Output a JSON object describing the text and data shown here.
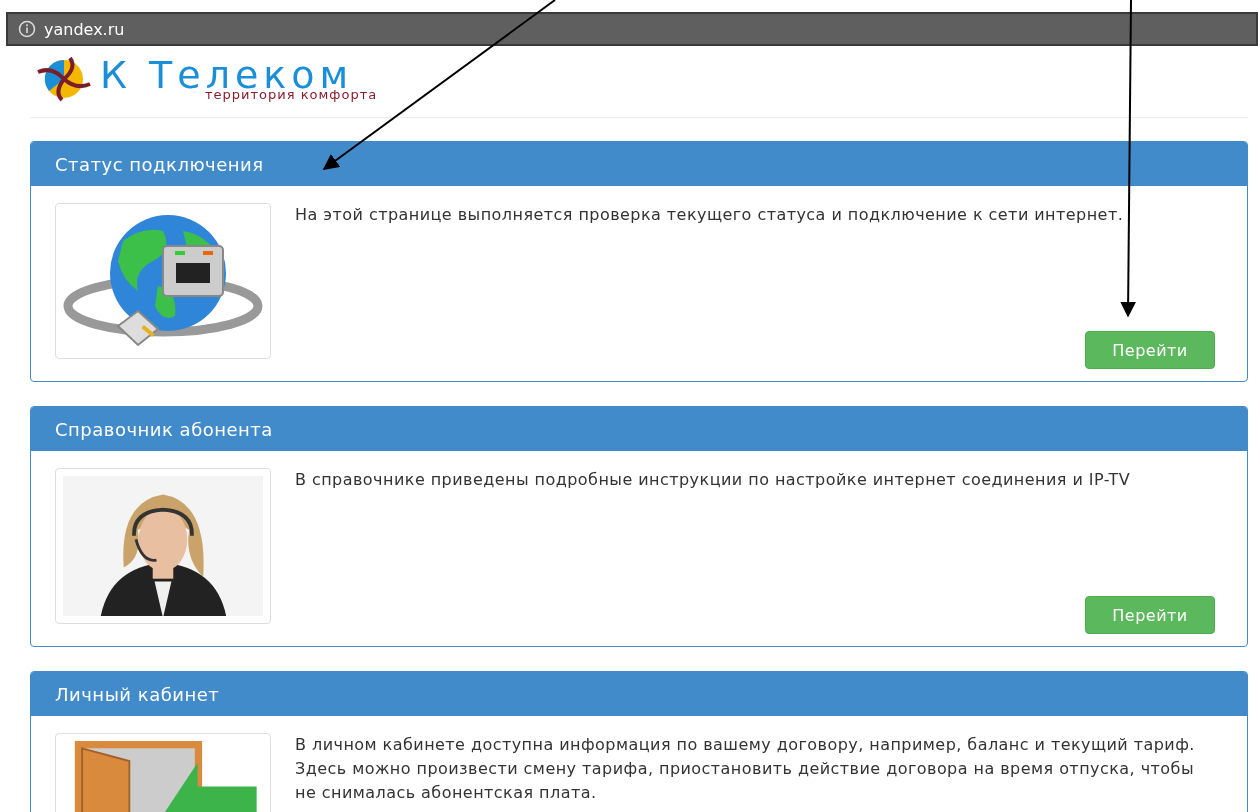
{
  "address_bar": {
    "url": "yandex.ru"
  },
  "logo": {
    "name": "К Телеком",
    "tagline": "территория комфорта"
  },
  "panels": [
    {
      "title": "Статус подключения",
      "kind": "network",
      "text": "На этой странице выполняется проверка текущего статуса и подключение к сети интернет.",
      "button": "Перейти"
    },
    {
      "title": "Справочник абонента",
      "kind": "picture",
      "text": "В справочнике приведены подробные инструкции по настройке интернет соединения и IP-TV",
      "button": "Перейти"
    },
    {
      "title": "Личный кабинет",
      "kind": "door",
      "text": "В личном кабинете доступна информация по вашему договору, например, баланс и текущий тариф. Здесь можно произвести смену тарифа, приостановить действие договора на время отпуска, чтобы не снималась абонентская плата."
    }
  ]
}
